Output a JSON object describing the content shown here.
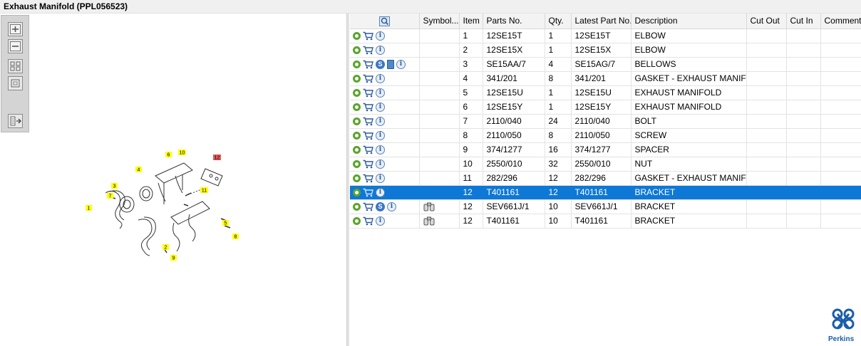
{
  "window": {
    "title": "Exhaust Manifold (PPL056523)"
  },
  "toolbar": {
    "buttons": [
      "zoom-in",
      "zoom-out",
      "fit-page",
      "actual-size",
      "export"
    ]
  },
  "diagram": {
    "callouts": [
      "1",
      "2",
      "3",
      "4",
      "5",
      "6",
      "7",
      "8",
      "9",
      "10",
      "11",
      "12"
    ],
    "highlighted_callout": "12",
    "highlight_color": "#e05a5a",
    "callout_color": "#ffff00"
  },
  "table": {
    "columns": [
      "",
      "Symbol...",
      "Item",
      "Parts No.",
      "Qty.",
      "Latest Part No.",
      "Description",
      "Cut Out",
      "Cut In",
      "Comment"
    ],
    "rows": [
      {
        "icons": [
          "gear",
          "cart",
          "info"
        ],
        "item": "1",
        "parts_no": "12SE15T",
        "qty": "1",
        "latest": "12SE15T",
        "desc": "ELBOW"
      },
      {
        "icons": [
          "gear",
          "cart",
          "info"
        ],
        "item": "2",
        "parts_no": "12SE15X",
        "qty": "1",
        "latest": "12SE15X",
        "desc": "ELBOW"
      },
      {
        "icons": [
          "gear",
          "cart",
          "s",
          "doc",
          "info"
        ],
        "item": "3",
        "parts_no": "SE15AA/7",
        "qty": "4",
        "latest": "SE15AG/7",
        "desc": "BELLOWS"
      },
      {
        "icons": [
          "gear",
          "cart",
          "info"
        ],
        "item": "4",
        "parts_no": "341/201",
        "qty": "8",
        "latest": "341/201",
        "desc": "GASKET - EXHAUST MANIFOLD"
      },
      {
        "icons": [
          "gear",
          "cart",
          "info"
        ],
        "item": "5",
        "parts_no": "12SE15U",
        "qty": "1",
        "latest": "12SE15U",
        "desc": "EXHAUST MANIFOLD"
      },
      {
        "icons": [
          "gear",
          "cart",
          "info"
        ],
        "item": "6",
        "parts_no": "12SE15Y",
        "qty": "1",
        "latest": "12SE15Y",
        "desc": "EXHAUST MANIFOLD"
      },
      {
        "icons": [
          "gear",
          "cart",
          "info"
        ],
        "item": "7",
        "parts_no": "2110/040",
        "qty": "24",
        "latest": "2110/040",
        "desc": "BOLT"
      },
      {
        "icons": [
          "gear",
          "cart",
          "info"
        ],
        "item": "8",
        "parts_no": "2110/050",
        "qty": "8",
        "latest": "2110/050",
        "desc": "SCREW"
      },
      {
        "icons": [
          "gear",
          "cart",
          "info"
        ],
        "item": "9",
        "parts_no": "374/1277",
        "qty": "16",
        "latest": "374/1277",
        "desc": "SPACER"
      },
      {
        "icons": [
          "gear",
          "cart",
          "info"
        ],
        "item": "10",
        "parts_no": "2550/010",
        "qty": "32",
        "latest": "2550/010",
        "desc": "NUT"
      },
      {
        "icons": [
          "gear",
          "cart",
          "info"
        ],
        "item": "11",
        "parts_no": "282/296",
        "qty": "12",
        "latest": "282/296",
        "desc": "GASKET - EXHAUST MANIFOLD"
      },
      {
        "icons": [
          "gear",
          "cart",
          "info"
        ],
        "item": "12",
        "parts_no": "T401161",
        "qty": "12",
        "latest": "T401161",
        "desc": "BRACKET",
        "selected": true
      },
      {
        "icons": [
          "gear",
          "cart",
          "s",
          "info"
        ],
        "symbol": "binoculars",
        "item": "12",
        "parts_no": "SEV661J/1",
        "qty": "10",
        "latest": "SEV661J/1",
        "desc": "BRACKET"
      },
      {
        "icons": [
          "gear",
          "cart",
          "info"
        ],
        "symbol": "binoculars",
        "item": "12",
        "parts_no": "T401161",
        "qty": "10",
        "latest": "T401161",
        "desc": "BRACKET"
      }
    ]
  },
  "brand": {
    "name": "Perkins",
    "color": "#1a5ea8"
  },
  "colors": {
    "selection": "#0e78d6",
    "gear": "#5aa52b",
    "info": "#2e5c9f"
  }
}
